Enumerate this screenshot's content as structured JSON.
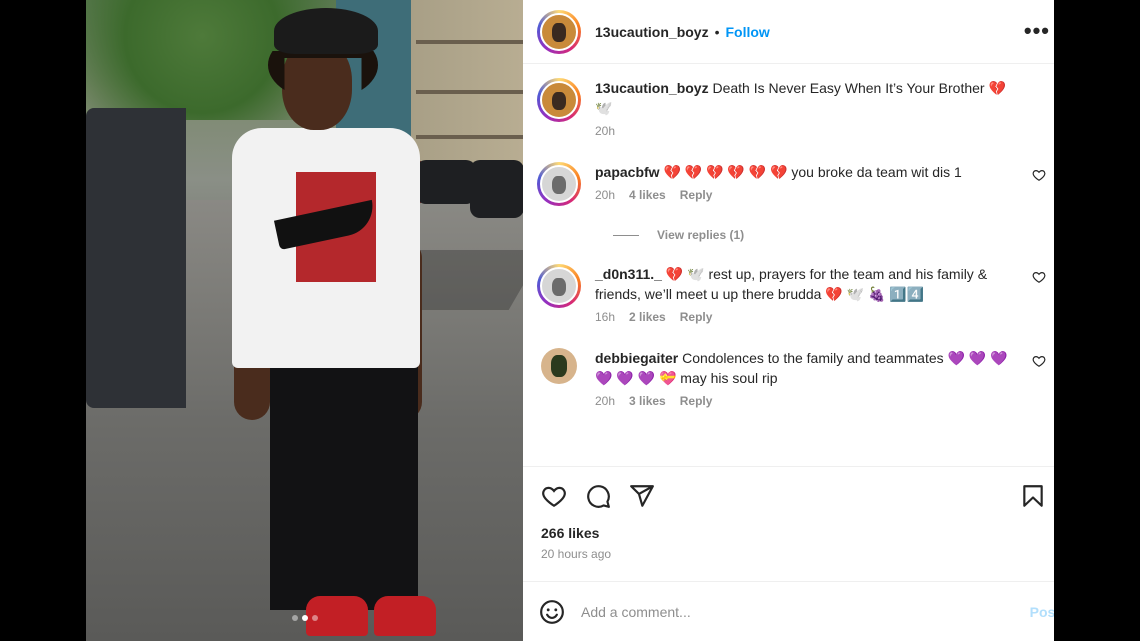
{
  "post": {
    "author": "13ucaution_boyz",
    "follow_label": "Follow",
    "separator": "•",
    "more_label": "•••",
    "caption_user": "13ucaution_boyz",
    "caption_text": " Death Is Never Easy When It’s Your Brother 💔 🕊️",
    "caption_time": "20h",
    "likes": "266 likes",
    "time_ago": "20 hours ago",
    "carousel_total": 3,
    "carousel_active": 2
  },
  "comments": [
    {
      "user": "papacbfw",
      "text": " 💔 💔 💔 💔 💔 💔  you broke da team wit dis 1",
      "time": "20h",
      "likes": "4 likes",
      "reply": "Reply"
    },
    {
      "user": "_d0n311._",
      "text": " 💔 🕊️  rest up, prayers for the team and his family & friends, we’ll meet u up there brudda 💔 🕊️ 🍇 1️⃣4️⃣",
      "time": "16h",
      "likes": "2 likes",
      "reply": "Reply"
    },
    {
      "user": "debbiegaiter",
      "text": " Condolences to the family and teammates 💜 💜 💜 💜 💜 💜 💝  may his soul rip",
      "time": "20h",
      "likes": "3 likes",
      "reply": "Reply"
    }
  ],
  "view_replies": "View replies (1)",
  "add_comment": {
    "placeholder": "Add a comment...",
    "post_label": "Post"
  },
  "icons": {
    "like": "heart-icon",
    "comment": "comment-icon",
    "share": "send-icon",
    "save": "bookmark-icon",
    "emoji": "emoji-icon",
    "more": "more-icon"
  },
  "colors": {
    "link": "#0095f6",
    "text": "#262626",
    "muted": "#8e8e8e",
    "post_disabled": "#b2dffc"
  }
}
